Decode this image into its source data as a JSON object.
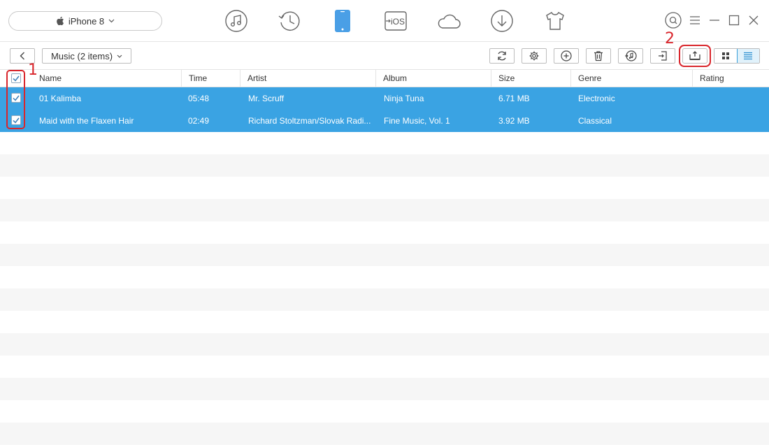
{
  "device": {
    "name": "iPhone 8"
  },
  "nav": {
    "items": [
      {
        "name": "music"
      },
      {
        "name": "history"
      },
      {
        "name": "device",
        "active": true
      },
      {
        "name": "to-ios",
        "label": "iOS"
      },
      {
        "name": "cloud"
      },
      {
        "name": "download"
      },
      {
        "name": "shirt"
      }
    ]
  },
  "toolbar": {
    "category": "Music (2 items)"
  },
  "table": {
    "columns": [
      "Name",
      "Time",
      "Artist",
      "Album",
      "Size",
      "Genre",
      "Rating"
    ],
    "rows": [
      {
        "name": "01 Kalimba",
        "time": "05:48",
        "artist": "Mr. Scruff",
        "album": "Ninja Tuna",
        "size": "6.71 MB",
        "genre": "Electronic",
        "rating": ""
      },
      {
        "name": "Maid with the Flaxen Hair",
        "time": "02:49",
        "artist": "Richard Stoltzman/Slovak Radi...",
        "album": "Fine Music, Vol. 1",
        "size": "3.92 MB",
        "genre": "Classical",
        "rating": ""
      }
    ]
  },
  "annotations": {
    "one": "1",
    "two": "2"
  },
  "colors": {
    "selection": "#3aa3e3",
    "annotation": "#d9262c",
    "active_nav": "#4a9fe6"
  }
}
